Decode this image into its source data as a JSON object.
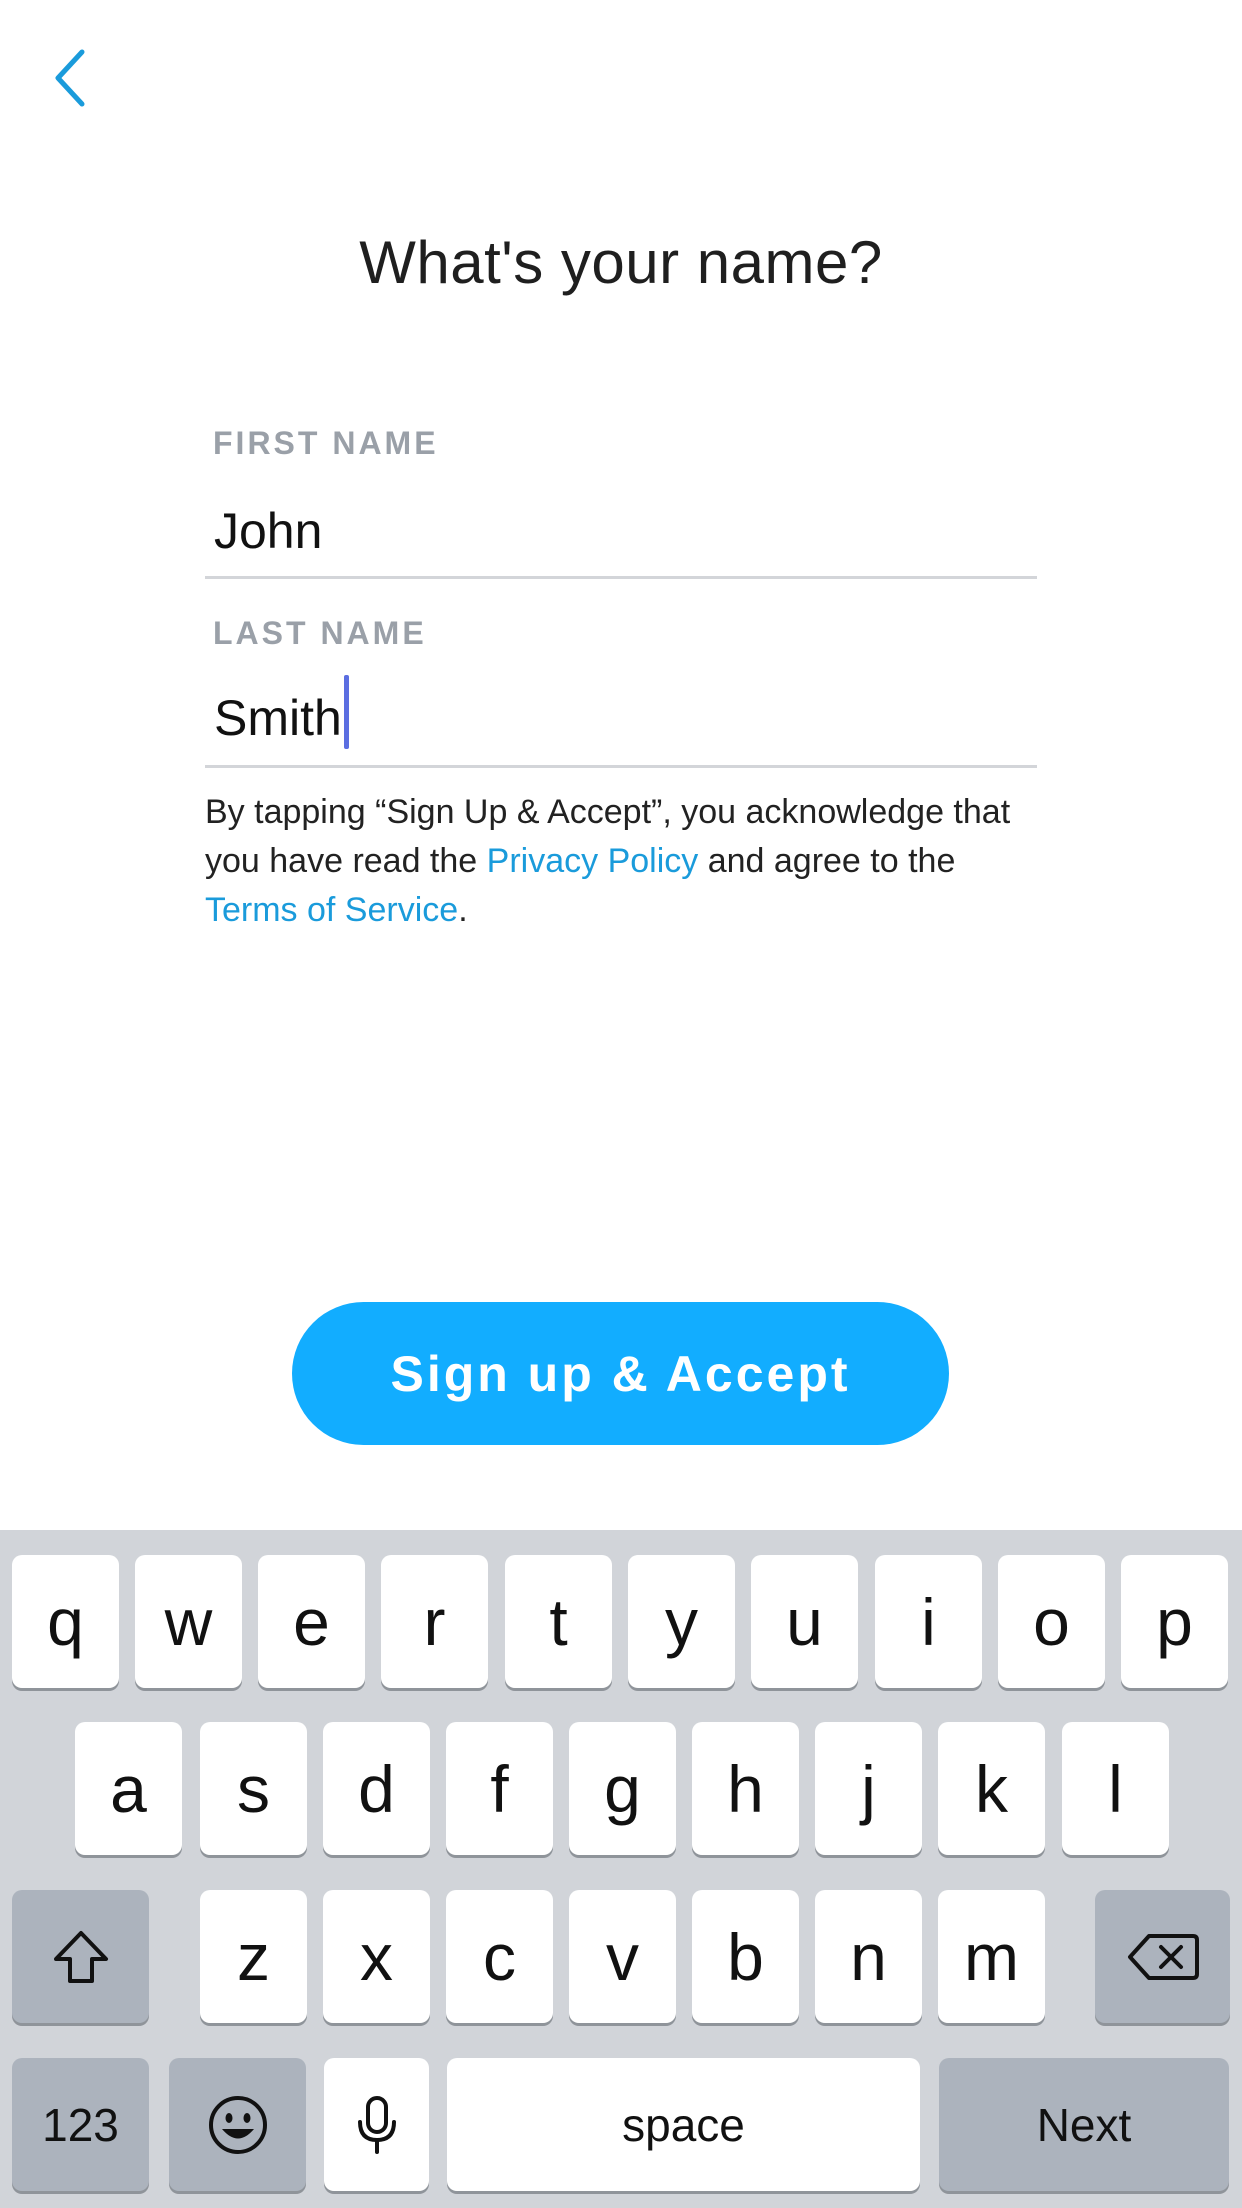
{
  "header": {
    "back_icon": "chevron-left-icon"
  },
  "title": "What's your name?",
  "form": {
    "first_name": {
      "label": "FIRST NAME",
      "value": "John"
    },
    "last_name": {
      "label": "LAST NAME",
      "value": "Smith"
    }
  },
  "legal": {
    "prefix": "By tapping “Sign Up & Accept”, you acknowledge that you have read the ",
    "privacy_link": "Privacy Policy",
    "middle": " and agree to the ",
    "terms_link": "Terms of Service",
    "suffix": "."
  },
  "cta": {
    "label": "Sign up & Accept"
  },
  "keyboard": {
    "row1": [
      "q",
      "w",
      "e",
      "r",
      "t",
      "y",
      "u",
      "i",
      "o",
      "p"
    ],
    "row2": [
      "a",
      "s",
      "d",
      "f",
      "g",
      "h",
      "j",
      "k",
      "l"
    ],
    "row3": [
      "z",
      "x",
      "c",
      "v",
      "b",
      "n",
      "m"
    ],
    "numbers_label": "123",
    "space_label": "space",
    "return_label": "Next",
    "shift_icon": "shift-icon",
    "delete_icon": "delete-icon",
    "emoji_icon": "emoji-icon",
    "mic_icon": "microphone-icon"
  },
  "colors": {
    "accent": "#12adff",
    "link": "#1a9bdb",
    "keyboard_bg": "#d1d4d9",
    "key_dark": "#acb3bd"
  }
}
